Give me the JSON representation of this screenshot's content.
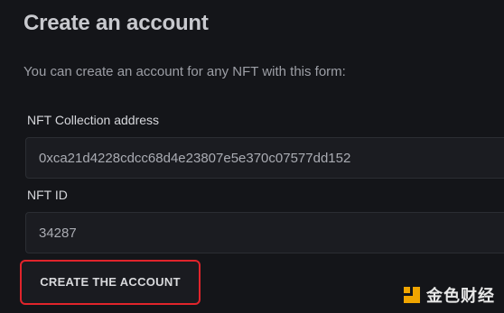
{
  "page": {
    "title": "Create an account",
    "subtitle": "You can create an account for any NFT with this form:"
  },
  "form": {
    "collection_label": "NFT Collection address",
    "collection_value": "0xca21d4228cdcc68d4e23807e5e370c07577dd152",
    "id_label": "NFT ID",
    "id_value": "34287",
    "submit_label": "CREATE THE ACCOUNT",
    "submit_highlight_color": "#e0242b"
  },
  "watermark": {
    "text": "金色财经",
    "logo_icon": "golden-finance-logo-icon",
    "logo_color": "#f0a500"
  }
}
